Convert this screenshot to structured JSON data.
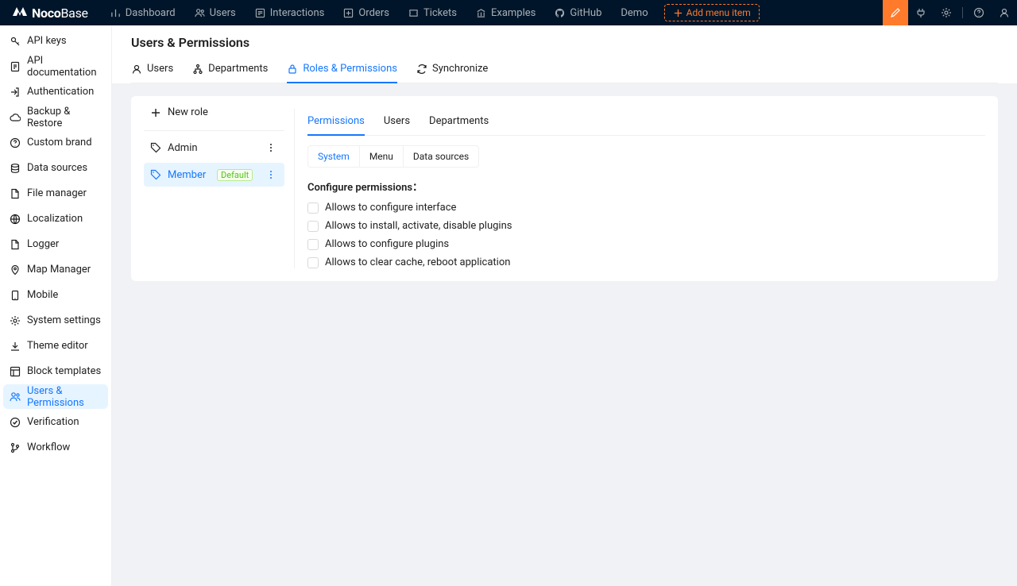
{
  "brand": {
    "name_bold": "Noco",
    "name_light": "Base"
  },
  "topnav": {
    "items": [
      {
        "label": "Dashboard",
        "icon": "chart"
      },
      {
        "label": "Users",
        "icon": "users"
      },
      {
        "label": "Interactions",
        "icon": "form"
      },
      {
        "label": "Orders",
        "icon": "plus-square"
      },
      {
        "label": "Tickets",
        "icon": "ticket"
      },
      {
        "label": "Examples",
        "icon": "bank"
      },
      {
        "label": "GitHub",
        "icon": "github"
      },
      {
        "label": "Demo",
        "icon": ""
      }
    ],
    "add_label": "Add menu item"
  },
  "sidebar": {
    "items": [
      {
        "label": "API keys",
        "icon": "key"
      },
      {
        "label": "API documentation",
        "icon": "doc"
      },
      {
        "label": "Authentication",
        "icon": "login"
      },
      {
        "label": "Backup & Restore",
        "icon": "cloud"
      },
      {
        "label": "Custom brand",
        "icon": "question"
      },
      {
        "label": "Data sources",
        "icon": "db"
      },
      {
        "label": "File manager",
        "icon": "file"
      },
      {
        "label": "Localization",
        "icon": "globe"
      },
      {
        "label": "Logger",
        "icon": "file"
      },
      {
        "label": "Map Manager",
        "icon": "pin"
      },
      {
        "label": "Mobile",
        "icon": "mobile"
      },
      {
        "label": "System settings",
        "icon": "gear"
      },
      {
        "label": "Theme editor",
        "icon": "download"
      },
      {
        "label": "Block templates",
        "icon": "layout"
      },
      {
        "label": "Users & Permissions",
        "icon": "users",
        "active": true
      },
      {
        "label": "Verification",
        "icon": "check"
      },
      {
        "label": "Workflow",
        "icon": "branch"
      }
    ]
  },
  "page": {
    "title": "Users & Permissions",
    "tabs": [
      {
        "label": "Users",
        "icon": "user"
      },
      {
        "label": "Departments",
        "icon": "tree"
      },
      {
        "label": "Roles & Permissions",
        "icon": "lock",
        "active": true
      },
      {
        "label": "Synchronize",
        "icon": "sync"
      }
    ]
  },
  "roles": {
    "new_label": "New role",
    "items": [
      {
        "label": "Admin",
        "default": false,
        "selected": false
      },
      {
        "label": "Member",
        "default": true,
        "selected": true
      }
    ],
    "default_badge": "Default"
  },
  "perm_tabs": [
    {
      "label": "Permissions",
      "active": true
    },
    {
      "label": "Users"
    },
    {
      "label": "Departments"
    }
  ],
  "sub_tabs": [
    {
      "label": "System",
      "active": true
    },
    {
      "label": "Menu"
    },
    {
      "label": "Data sources"
    }
  ],
  "permissions": {
    "heading": "Configure permissions：",
    "items": [
      "Allows to configure interface",
      "Allows to install, activate, disable plugins",
      "Allows to configure plugins",
      "Allows to clear cache, reboot application"
    ]
  }
}
